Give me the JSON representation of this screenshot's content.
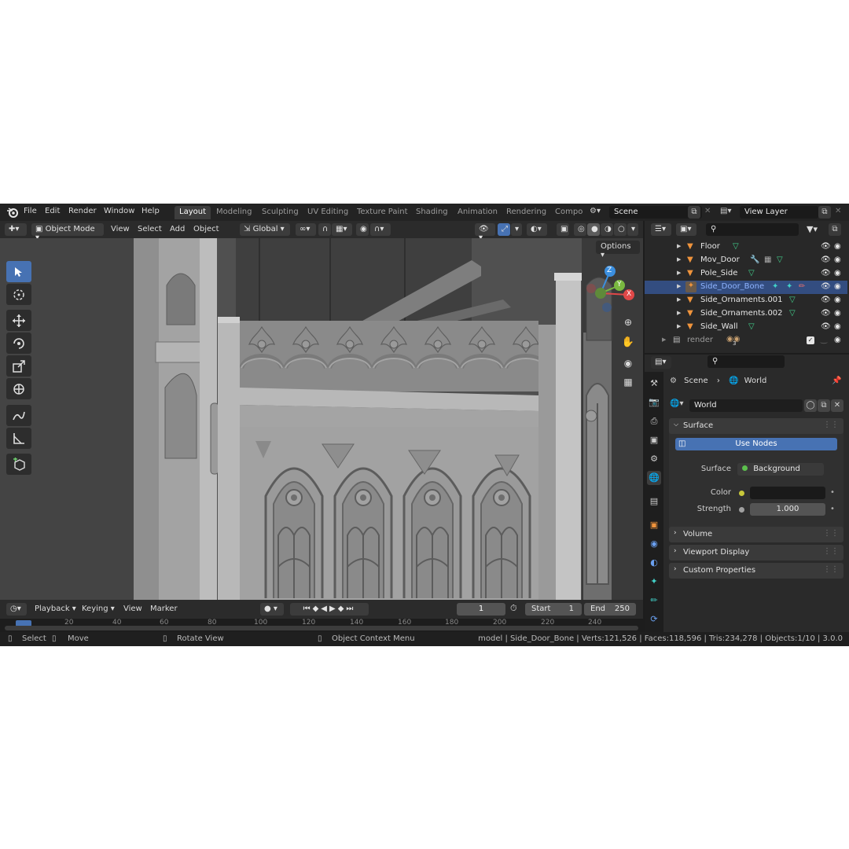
{
  "menubar": {
    "items": [
      "File",
      "Edit",
      "Render",
      "Window",
      "Help"
    ],
    "workspaces": [
      "Layout",
      "Modeling",
      "Sculpting",
      "UV Editing",
      "Texture Paint",
      "Shading",
      "Animation",
      "Rendering",
      "Compo"
    ],
    "active_workspace": "Layout",
    "scene": "Scene",
    "view_layer": "View Layer"
  },
  "viewport": {
    "mode": "Object Mode",
    "menus": [
      "View",
      "Select",
      "Add",
      "Object"
    ],
    "transform_orientation": "Global",
    "options_label": "Options",
    "gizmo": {
      "z": "Z",
      "y": "Y",
      "x": "X"
    }
  },
  "outliner": {
    "rows": [
      {
        "name": "Floor",
        "selected": false
      },
      {
        "name": "Mov_Door",
        "selected": false
      },
      {
        "name": "Pole_Side",
        "selected": false
      },
      {
        "name": "Side_Door_Bone",
        "selected": true
      },
      {
        "name": "Side_Ornaments.001",
        "selected": false
      },
      {
        "name": "Side_Ornaments.002",
        "selected": false
      },
      {
        "name": "Side_Wall",
        "selected": false
      },
      {
        "name": "render",
        "selected": false
      }
    ],
    "render_badge": "3"
  },
  "properties": {
    "breadcrumb": {
      "scene": "Scene",
      "world": "World"
    },
    "world_name": "World",
    "surface_panel": "Surface",
    "use_nodes": "Use Nodes",
    "surface_label": "Surface",
    "surface_value": "Background",
    "color_label": "Color",
    "strength_label": "Strength",
    "strength_value": "1.000",
    "panels": [
      "Volume",
      "Viewport Display",
      "Custom Properties"
    ],
    "colors": {
      "surface_dot": "#5cc04d",
      "color_dot": "#c8c83a",
      "use_nodes": "#4772b3"
    }
  },
  "timeline": {
    "menus": [
      "Playback",
      "Keying",
      "View",
      "Marker"
    ],
    "current_frame": "1",
    "start_label": "Start",
    "start_value": "1",
    "end_label": "End",
    "end_value": "250",
    "ruler": [
      "20",
      "40",
      "60",
      "80",
      "100",
      "120",
      "140",
      "160",
      "180",
      "200",
      "220",
      "240"
    ]
  },
  "statusbar": {
    "select": "Select",
    "move": "Move",
    "rotate": "Rotate View",
    "context": "Object Context Menu",
    "stats": "model | Side_Door_Bone | Verts:121,526 | Faces:118,596 | Tris:234,278 | Objects:1/10 | 3.0.0"
  }
}
